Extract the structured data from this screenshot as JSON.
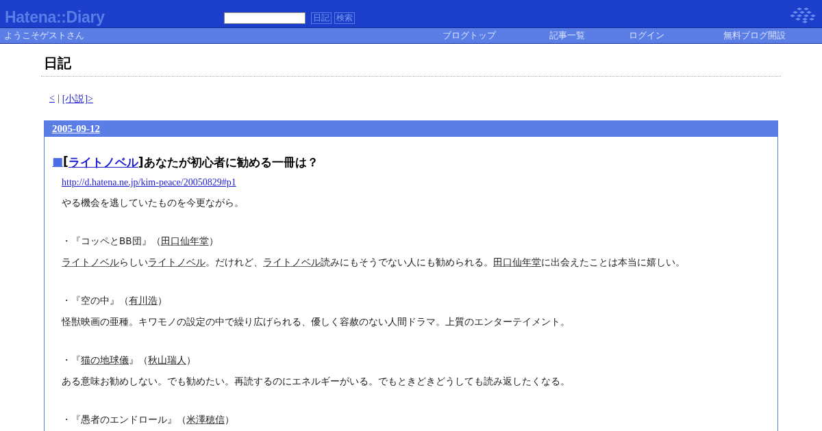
{
  "header": {
    "logo": "Hatena::Diary",
    "search_buttons": [
      "日記",
      "検索"
    ]
  },
  "nav": {
    "welcome": "ようこそゲストさん",
    "links": [
      "ブログトップ",
      "記事一覧",
      "ログイン",
      "無料ブログ開設"
    ]
  },
  "diary_title": "日記",
  "pager": {
    "prev": "<",
    "separator": "|",
    "next": "[小説]>"
  },
  "day": {
    "date": "2005-09-12",
    "section": {
      "mark": "■",
      "brackets": [
        "[",
        "]"
      ],
      "category": "ライトノベル",
      "title": "あなたが初心者に勧める一冊は？",
      "url": "http://d.hatena.ne.jp/kim-peace/20050829#p1",
      "intro": [
        {
          "text": "やる機会を逃していたものを今更ながら。",
          "keyword": false
        }
      ],
      "books": [
        {
          "line": [
            {
              "text": "・『コッペとBB団』（",
              "keyword": false
            },
            {
              "text": "田口仙年堂",
              "keyword": true
            },
            {
              "text": "）",
              "keyword": false
            }
          ],
          "comment": [
            {
              "text": "ライトノベル",
              "keyword": true
            },
            {
              "text": "らしい",
              "keyword": false
            },
            {
              "text": "ライトノベル",
              "keyword": true
            },
            {
              "text": "。だけれど、",
              "keyword": false
            },
            {
              "text": "ライトノベル",
              "keyword": true
            },
            {
              "text": "読みにもそうでない人にも勧められる。",
              "keyword": false
            },
            {
              "text": "田口仙年堂",
              "keyword": true
            },
            {
              "text": "に出会えたことは本当に嬉しい。",
              "keyword": false
            }
          ]
        },
        {
          "line": [
            {
              "text": "・『空の中』（",
              "keyword": false
            },
            {
              "text": "有川浩",
              "keyword": true
            },
            {
              "text": "）",
              "keyword": false
            }
          ],
          "comment": [
            {
              "text": "怪獣映画の亜種。キワモノの設定の中で繰り広げられる、優しく容赦のない人間ドラマ。上質のエンターテイメント。",
              "keyword": false
            }
          ]
        },
        {
          "line": [
            {
              "text": "・『",
              "keyword": false
            },
            {
              "text": "猫の地球儀",
              "keyword": true
            },
            {
              "text": "』（",
              "keyword": false
            },
            {
              "text": "秋山瑞人",
              "keyword": true
            },
            {
              "text": "）",
              "keyword": false
            }
          ],
          "comment": [
            {
              "text": "ある意味お勧めしない。でも勧めたい。再読するのにエネルギーがいる。でもときどきどうしても読み返したくなる。",
              "keyword": false
            }
          ]
        },
        {
          "line": [
            {
              "text": "・『愚者のエンドロール』（",
              "keyword": false
            },
            {
              "text": "米澤穂信",
              "keyword": true
            },
            {
              "text": "）",
              "keyword": false
            }
          ]
        }
      ]
    }
  }
}
